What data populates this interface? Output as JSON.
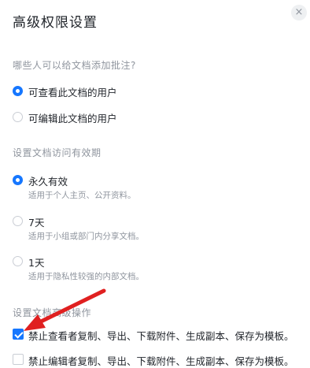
{
  "dialog": {
    "title": "高级权限设置",
    "close_glyph": "×"
  },
  "comment_section": {
    "label": "哪些人可以给文档添加批注?",
    "options": [
      {
        "label": "可查看此文档的用户",
        "selected": true
      },
      {
        "label": "可编辑此文档的用户",
        "selected": false
      }
    ]
  },
  "validity_section": {
    "label": "设置文档访问有效期",
    "options": [
      {
        "label": "永久有效",
        "desc": "适用于个人主页、公开资料。",
        "selected": true
      },
      {
        "label": "7天",
        "desc": "适用于小组或部门内分享文档。",
        "selected": false
      },
      {
        "label": "1天",
        "desc": "适用于隐私性较强的内部文档。",
        "selected": false
      }
    ]
  },
  "advanced_section": {
    "label": "设置文档高级操作",
    "checks": [
      {
        "label": "禁止查看者复制、导出、下载附件、生成副本、保存为模板。",
        "checked": true
      },
      {
        "label": "禁止编辑者复制、导出、下载附件、生成副本、保存为模板。",
        "checked": false
      }
    ]
  },
  "colors": {
    "accent": "#1677ff",
    "annotation_arrow": "#e02020"
  }
}
